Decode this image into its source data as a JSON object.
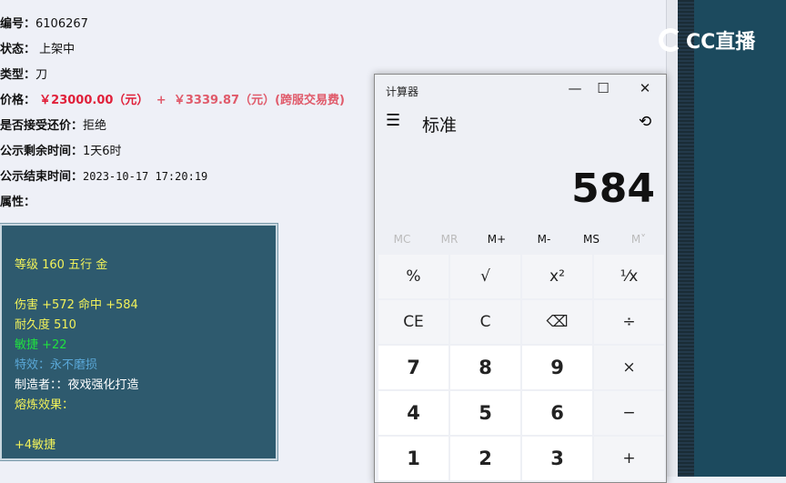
{
  "listing": {
    "id_label": "编号：",
    "id": "6106267",
    "status_label": "状态：",
    "status": "上架中",
    "type_label": "类型：",
    "type": "刀",
    "price_label": "价格：",
    "price": "￥23000.00（元）",
    "plus": "+",
    "fee": "￥3339.87（元）(跨服交易费)",
    "bargain_label": "是否接受还价：",
    "bargain": "拒绝",
    "remaining_label": "公示剩余时间：",
    "remaining": "1天6时",
    "end_label": "公示结束时间：",
    "end": "2023-10-17 17:20:19",
    "attr_label": "属性："
  },
  "attributes": {
    "level": "等级 160 五行 金",
    "damage": "伤害 +572 命中 +584",
    "durability": "耐久度 510",
    "agility": "敏捷 +22",
    "effect": "特效：永不磨损",
    "maker": "制造者：：夜戏强化打造",
    "refine": "熔炼效果：",
    "refine_value": "+4敏捷"
  },
  "logo": "CC直播",
  "calculator": {
    "title": "计算器",
    "mode": "标准",
    "display": "584",
    "memory": [
      "MC",
      "MR",
      "M+",
      "M-",
      "MS",
      "M˅"
    ],
    "keys": [
      [
        "%",
        "√",
        "x²",
        "¹⁄x"
      ],
      [
        "CE",
        "C",
        "⌫",
        "÷"
      ],
      [
        "7",
        "8",
        "9",
        "×"
      ],
      [
        "4",
        "5",
        "6",
        "−"
      ],
      [
        "1",
        "2",
        "3",
        "+"
      ]
    ]
  }
}
